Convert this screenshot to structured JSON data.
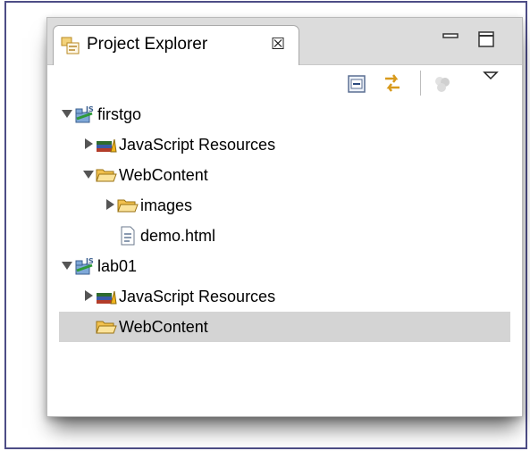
{
  "view": {
    "tab_title": "Project Explorer",
    "tab_close_glyph": "☒",
    "tab_icon": "project-explorer-icon"
  },
  "toolbar": {
    "buttons": [
      "collapse-all-icon",
      "link-with-editor-icon",
      "working-sets-icon",
      "view-menu-icon"
    ]
  },
  "tree": [
    {
      "label": "firstgo",
      "depth": 0,
      "expanded": true,
      "icon": "js-project-icon"
    },
    {
      "label": "JavaScript Resources",
      "depth": 1,
      "expanded": false,
      "icon": "js-resources-icon"
    },
    {
      "label": "WebContent",
      "depth": 1,
      "expanded": true,
      "icon": "folder-open-icon"
    },
    {
      "label": "images",
      "depth": 2,
      "expanded": false,
      "icon": "folder-open-icon"
    },
    {
      "label": "demo.html",
      "depth": 2,
      "icon": "html-file-icon"
    },
    {
      "label": "lab01",
      "depth": 0,
      "expanded": true,
      "icon": "js-project-icon"
    },
    {
      "label": "JavaScript Resources",
      "depth": 1,
      "expanded": false,
      "icon": "js-resources-icon"
    },
    {
      "label": "WebContent",
      "depth": 1,
      "icon": "folder-open-icon",
      "selected": true
    }
  ],
  "colors": {
    "frame": "#4d4d86",
    "selection": "#d4d4d4",
    "folder": "#f2c14e"
  }
}
